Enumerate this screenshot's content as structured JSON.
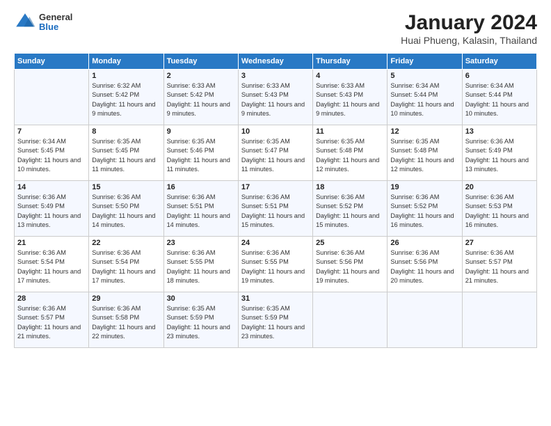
{
  "header": {
    "logo_general": "General",
    "logo_blue": "Blue",
    "month_title": "January 2024",
    "location": "Huai Phueng, Kalasin, Thailand"
  },
  "days_of_week": [
    "Sunday",
    "Monday",
    "Tuesday",
    "Wednesday",
    "Thursday",
    "Friday",
    "Saturday"
  ],
  "weeks": [
    [
      {
        "day": "",
        "sunrise": "",
        "sunset": "",
        "daylight": ""
      },
      {
        "day": "1",
        "sunrise": "6:32 AM",
        "sunset": "5:42 PM",
        "daylight": "11 hours and 9 minutes."
      },
      {
        "day": "2",
        "sunrise": "6:33 AM",
        "sunset": "5:42 PM",
        "daylight": "11 hours and 9 minutes."
      },
      {
        "day": "3",
        "sunrise": "6:33 AM",
        "sunset": "5:43 PM",
        "daylight": "11 hours and 9 minutes."
      },
      {
        "day": "4",
        "sunrise": "6:33 AM",
        "sunset": "5:43 PM",
        "daylight": "11 hours and 9 minutes."
      },
      {
        "day": "5",
        "sunrise": "6:34 AM",
        "sunset": "5:44 PM",
        "daylight": "11 hours and 10 minutes."
      },
      {
        "day": "6",
        "sunrise": "6:34 AM",
        "sunset": "5:44 PM",
        "daylight": "11 hours and 10 minutes."
      }
    ],
    [
      {
        "day": "7",
        "sunrise": "6:34 AM",
        "sunset": "5:45 PM",
        "daylight": "11 hours and 10 minutes."
      },
      {
        "day": "8",
        "sunrise": "6:35 AM",
        "sunset": "5:45 PM",
        "daylight": "11 hours and 11 minutes."
      },
      {
        "day": "9",
        "sunrise": "6:35 AM",
        "sunset": "5:46 PM",
        "daylight": "11 hours and 11 minutes."
      },
      {
        "day": "10",
        "sunrise": "6:35 AM",
        "sunset": "5:47 PM",
        "daylight": "11 hours and 11 minutes."
      },
      {
        "day": "11",
        "sunrise": "6:35 AM",
        "sunset": "5:48 PM",
        "daylight": "11 hours and 12 minutes."
      },
      {
        "day": "12",
        "sunrise": "6:35 AM",
        "sunset": "5:48 PM",
        "daylight": "11 hours and 12 minutes."
      },
      {
        "day": "13",
        "sunrise": "6:36 AM",
        "sunset": "5:49 PM",
        "daylight": "11 hours and 13 minutes."
      }
    ],
    [
      {
        "day": "14",
        "sunrise": "6:36 AM",
        "sunset": "5:49 PM",
        "daylight": "11 hours and 13 minutes."
      },
      {
        "day": "15",
        "sunrise": "6:36 AM",
        "sunset": "5:50 PM",
        "daylight": "11 hours and 14 minutes."
      },
      {
        "day": "16",
        "sunrise": "6:36 AM",
        "sunset": "5:51 PM",
        "daylight": "11 hours and 14 minutes."
      },
      {
        "day": "17",
        "sunrise": "6:36 AM",
        "sunset": "5:51 PM",
        "daylight": "11 hours and 15 minutes."
      },
      {
        "day": "18",
        "sunrise": "6:36 AM",
        "sunset": "5:52 PM",
        "daylight": "11 hours and 15 minutes."
      },
      {
        "day": "19",
        "sunrise": "6:36 AM",
        "sunset": "5:52 PM",
        "daylight": "11 hours and 16 minutes."
      },
      {
        "day": "20",
        "sunrise": "6:36 AM",
        "sunset": "5:53 PM",
        "daylight": "11 hours and 16 minutes."
      }
    ],
    [
      {
        "day": "21",
        "sunrise": "6:36 AM",
        "sunset": "5:54 PM",
        "daylight": "11 hours and 17 minutes."
      },
      {
        "day": "22",
        "sunrise": "6:36 AM",
        "sunset": "5:54 PM",
        "daylight": "11 hours and 17 minutes."
      },
      {
        "day": "23",
        "sunrise": "6:36 AM",
        "sunset": "5:55 PM",
        "daylight": "11 hours and 18 minutes."
      },
      {
        "day": "24",
        "sunrise": "6:36 AM",
        "sunset": "5:55 PM",
        "daylight": "11 hours and 19 minutes."
      },
      {
        "day": "25",
        "sunrise": "6:36 AM",
        "sunset": "5:56 PM",
        "daylight": "11 hours and 19 minutes."
      },
      {
        "day": "26",
        "sunrise": "6:36 AM",
        "sunset": "5:56 PM",
        "daylight": "11 hours and 20 minutes."
      },
      {
        "day": "27",
        "sunrise": "6:36 AM",
        "sunset": "5:57 PM",
        "daylight": "11 hours and 21 minutes."
      }
    ],
    [
      {
        "day": "28",
        "sunrise": "6:36 AM",
        "sunset": "5:57 PM",
        "daylight": "11 hours and 21 minutes."
      },
      {
        "day": "29",
        "sunrise": "6:36 AM",
        "sunset": "5:58 PM",
        "daylight": "11 hours and 22 minutes."
      },
      {
        "day": "30",
        "sunrise": "6:35 AM",
        "sunset": "5:59 PM",
        "daylight": "11 hours and 23 minutes."
      },
      {
        "day": "31",
        "sunrise": "6:35 AM",
        "sunset": "5:59 PM",
        "daylight": "11 hours and 23 minutes."
      },
      {
        "day": "",
        "sunrise": "",
        "sunset": "",
        "daylight": ""
      },
      {
        "day": "",
        "sunrise": "",
        "sunset": "",
        "daylight": ""
      },
      {
        "day": "",
        "sunrise": "",
        "sunset": "",
        "daylight": ""
      }
    ]
  ]
}
